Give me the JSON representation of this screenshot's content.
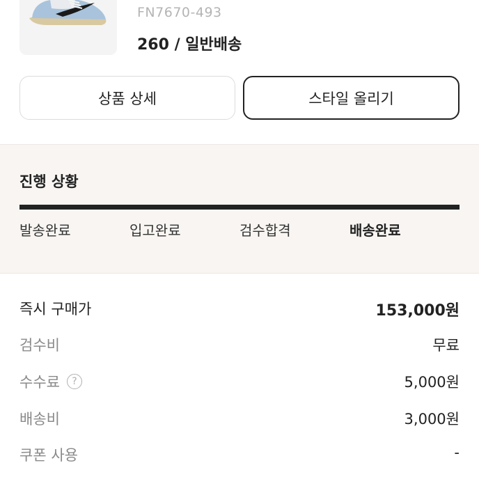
{
  "product": {
    "image": "sneaker-thumbnail",
    "model_number": "FN7670-493",
    "size_shipping": "260 / 일반배송"
  },
  "buttons": {
    "detail": "상품 상세",
    "style": "스타일 올리기"
  },
  "progress": {
    "title": "진행 상황",
    "completed_fraction": 1.0,
    "steps": [
      {
        "label": "발송완료",
        "active": false
      },
      {
        "label": "입고완료",
        "active": false
      },
      {
        "label": "검수합격",
        "active": false
      },
      {
        "label": "배송완료",
        "active": true
      }
    ]
  },
  "pricing": {
    "instant_price": {
      "label": "즉시 구매가",
      "value": "153,000원"
    },
    "inspection": {
      "label": "검수비",
      "value": "무료"
    },
    "fee": {
      "label": "수수료",
      "help": "?",
      "value": "5,000원"
    },
    "shipping": {
      "label": "배송비",
      "value": "3,000원"
    },
    "coupon": {
      "label": "쿠폰 사용",
      "value": "-"
    }
  },
  "colors": {
    "accent": "#222222",
    "muted_text": "#8a8a8a",
    "section_bg": "#f8f5f2"
  }
}
